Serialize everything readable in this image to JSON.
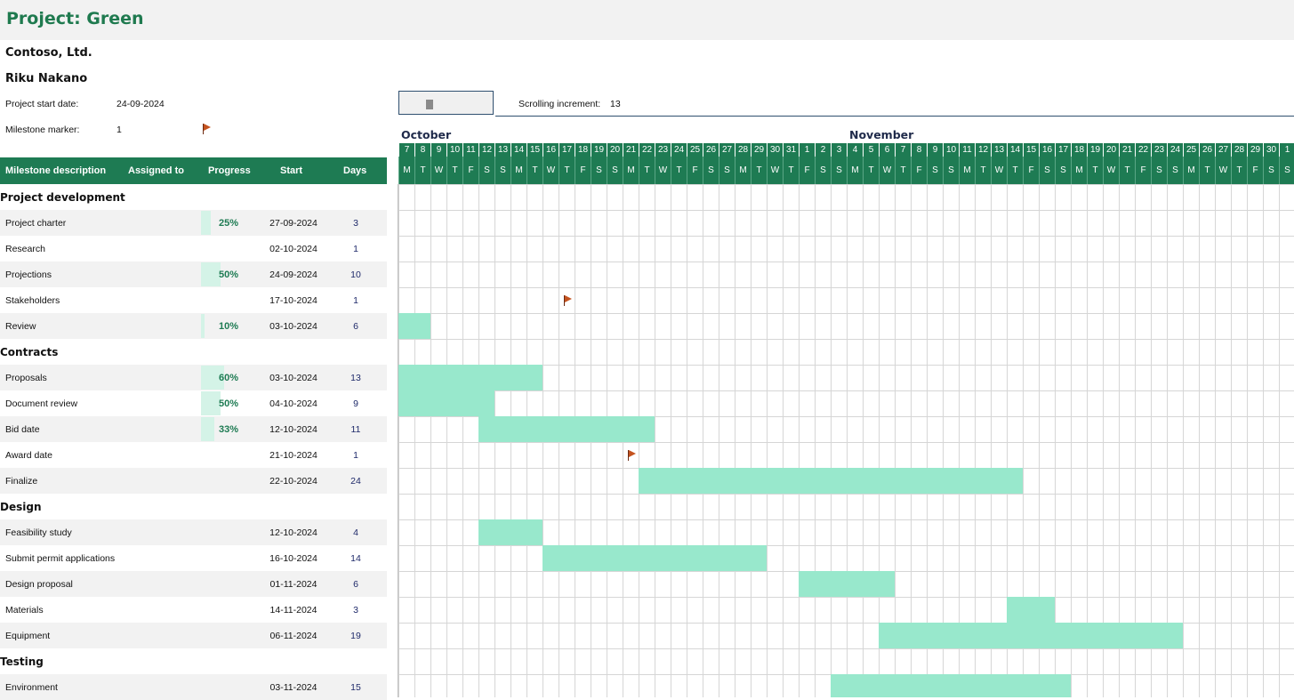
{
  "project_title": "Project: Green",
  "company": "Contoso, Ltd.",
  "manager": "Riku Nakano",
  "start_date_label": "Project start date:",
  "start_date_value": "24-09-2024",
  "milestone_marker_label": "Milestone marker:",
  "milestone_marker_value": "1",
  "scrolling_increment_label": "Scrolling increment:",
  "scrolling_increment_value": "13",
  "months": [
    "October",
    "November"
  ],
  "columns": {
    "description": "Milestone description",
    "assigned": "Assigned to",
    "progress": "Progress",
    "start": "Start",
    "days": "Days"
  },
  "timeline_days": [
    "7",
    "8",
    "9",
    "10",
    "11",
    "12",
    "13",
    "14",
    "15",
    "16",
    "17",
    "18",
    "19",
    "20",
    "21",
    "22",
    "23",
    "24",
    "25",
    "26",
    "27",
    "28",
    "29",
    "30",
    "31",
    "1",
    "2",
    "3",
    "4",
    "5",
    "6",
    "7",
    "8",
    "9",
    "10",
    "11",
    "12",
    "13",
    "14",
    "15",
    "16",
    "17",
    "18",
    "19",
    "20",
    "21",
    "22",
    "23",
    "24",
    "25",
    "26",
    "27",
    "28",
    "29",
    "30",
    "1"
  ],
  "timeline_weekdays": [
    "M",
    "T",
    "W",
    "T",
    "F",
    "S",
    "S",
    "M",
    "T",
    "W",
    "T",
    "F",
    "S",
    "S",
    "M",
    "T",
    "W",
    "T",
    "F",
    "S",
    "S",
    "M",
    "T",
    "W",
    "T",
    "F",
    "S",
    "S",
    "M",
    "T",
    "W",
    "T",
    "F",
    "S",
    "S",
    "M",
    "T",
    "W",
    "T",
    "F",
    "S",
    "S",
    "M",
    "T",
    "W",
    "T",
    "F",
    "S",
    "S",
    "M",
    "T",
    "W",
    "T",
    "F",
    "S",
    "S"
  ],
  "rows": [
    {
      "type": "section",
      "label": "Project development"
    },
    {
      "type": "task",
      "label": "Project charter",
      "progress": "25%",
      "progress_value": 0.25,
      "start": "27-09-2024",
      "days": "3"
    },
    {
      "type": "task",
      "label": "Research",
      "progress": "",
      "progress_value": 0,
      "start": "02-10-2024",
      "days": "1"
    },
    {
      "type": "task",
      "label": "Projections",
      "progress": "50%",
      "progress_value": 0.5,
      "start": "24-09-2024",
      "days": "10"
    },
    {
      "type": "task",
      "label": "Stakeholders",
      "progress": "",
      "progress_value": 0,
      "start": "17-10-2024",
      "days": "1",
      "milestone": true
    },
    {
      "type": "task",
      "label": "Review",
      "progress": "10%",
      "progress_value": 0.1,
      "start": "03-10-2024",
      "days": "6"
    },
    {
      "type": "section",
      "label": "Contracts"
    },
    {
      "type": "task",
      "label": "Proposals",
      "progress": "60%",
      "progress_value": 0.6,
      "start": "03-10-2024",
      "days": "13"
    },
    {
      "type": "task",
      "label": "Document review",
      "progress": "50%",
      "progress_value": 0.5,
      "start": "04-10-2024",
      "days": "9"
    },
    {
      "type": "task",
      "label": "Bid date",
      "progress": "33%",
      "progress_value": 0.33,
      "start": "12-10-2024",
      "days": "11"
    },
    {
      "type": "task",
      "label": "Award date",
      "progress": "",
      "progress_value": 0,
      "start": "21-10-2024",
      "days": "1",
      "milestone": true
    },
    {
      "type": "task",
      "label": "Finalize",
      "progress": "",
      "progress_value": 0,
      "start": "22-10-2024",
      "days": "24"
    },
    {
      "type": "section",
      "label": "Design"
    },
    {
      "type": "task",
      "label": "Feasibility study",
      "progress": "",
      "progress_value": 0,
      "start": "12-10-2024",
      "days": "4"
    },
    {
      "type": "task",
      "label": "Submit permit applications",
      "progress": "",
      "progress_value": 0,
      "start": "16-10-2024",
      "days": "14"
    },
    {
      "type": "task",
      "label": "Design proposal",
      "progress": "",
      "progress_value": 0,
      "start": "01-11-2024",
      "days": "6"
    },
    {
      "type": "task",
      "label": "Materials",
      "progress": "",
      "progress_value": 0,
      "start": "14-11-2024",
      "days": "3"
    },
    {
      "type": "task",
      "label": "Equipment",
      "progress": "",
      "progress_value": 0,
      "start": "06-11-2024",
      "days": "19"
    },
    {
      "type": "section",
      "label": "Testing"
    },
    {
      "type": "task",
      "label": "Environment",
      "progress": "",
      "progress_value": 0,
      "start": "03-11-2024",
      "days": "15"
    }
  ],
  "colors": {
    "accent": "#1e7b53",
    "bar": "#98e8cc",
    "progress_fill": "#d4f3e7",
    "flag": "#c4531f"
  }
}
